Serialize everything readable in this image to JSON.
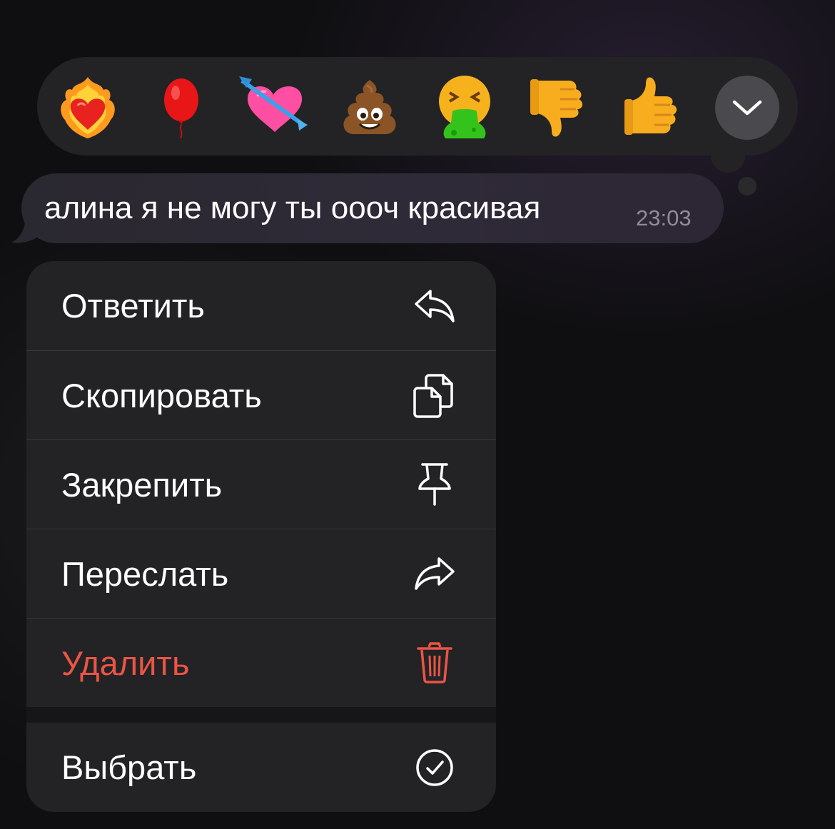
{
  "reactions": [
    {
      "name": "heart-on-fire"
    },
    {
      "name": "red-balloon"
    },
    {
      "name": "heart-with-arrow"
    },
    {
      "name": "pile-of-poo"
    },
    {
      "name": "face-vomiting"
    },
    {
      "name": "thumbs-down"
    },
    {
      "name": "thumbs-up"
    }
  ],
  "message": {
    "text": "алина я не могу ты оооч красивая",
    "time": "23:03"
  },
  "menu": {
    "reply": "Ответить",
    "copy": "Скопировать",
    "pin": "Закрепить",
    "forward": "Переслать",
    "delete": "Удалить",
    "select": "Выбрать"
  },
  "colors": {
    "danger": "#eb5545",
    "menu_bg": "#232325",
    "bubble_bg": "#2a2830"
  }
}
